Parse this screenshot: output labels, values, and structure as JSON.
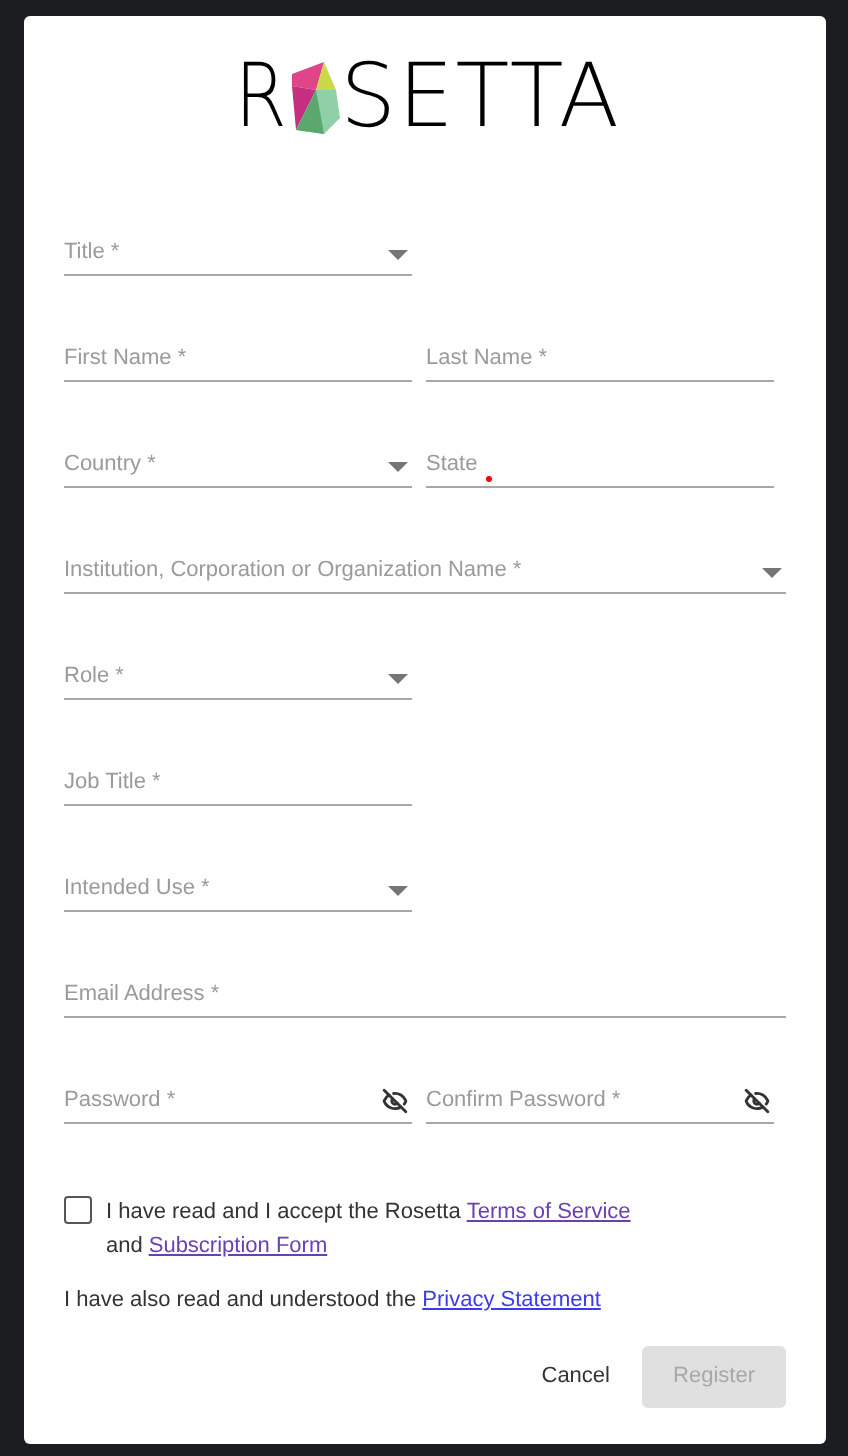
{
  "logo": {
    "left": "R",
    "right": "SETTA"
  },
  "rows": [
    {
      "kind": "half",
      "fields": [
        {
          "kind": "select",
          "label": "Title *"
        }
      ]
    },
    {
      "kind": "half",
      "fields": [
        {
          "kind": "text",
          "label": "First Name *"
        },
        {
          "kind": "text",
          "label": "Last Name *"
        }
      ]
    },
    {
      "kind": "half",
      "fields": [
        {
          "kind": "select",
          "label": "Country *"
        },
        {
          "kind": "text",
          "label": "State",
          "required_dot": true
        }
      ]
    },
    {
      "kind": "wide",
      "fields": [
        {
          "kind": "select",
          "label": "Institution, Corporation or Organization Name *"
        }
      ]
    },
    {
      "kind": "half",
      "fields": [
        {
          "kind": "select",
          "label": "Role *"
        }
      ]
    },
    {
      "kind": "half",
      "fields": [
        {
          "kind": "text",
          "label": "Job Title *"
        }
      ]
    },
    {
      "kind": "half",
      "fields": [
        {
          "kind": "select",
          "label": "Intended Use *"
        }
      ]
    },
    {
      "kind": "wide",
      "fields": [
        {
          "kind": "text",
          "label": "Email Address *"
        }
      ]
    },
    {
      "kind": "half",
      "fields": [
        {
          "kind": "password",
          "label": "Password *"
        },
        {
          "kind": "password",
          "label": "Confirm Password *"
        }
      ]
    }
  ],
  "agreement": {
    "checked": false,
    "text1": "I have read and I accept the Rosetta",
    "link1": {
      "label": "Terms of Service",
      "visited": true
    },
    "text2": "and",
    "link2": {
      "label": "Subscription Form",
      "visited": true
    }
  },
  "privacy": {
    "text": "I have also read and understood the",
    "link": {
      "label": "Privacy Statement",
      "visited": false
    }
  },
  "buttons": {
    "cancel": "Cancel",
    "register": {
      "label": "Register",
      "disabled": true
    }
  }
}
